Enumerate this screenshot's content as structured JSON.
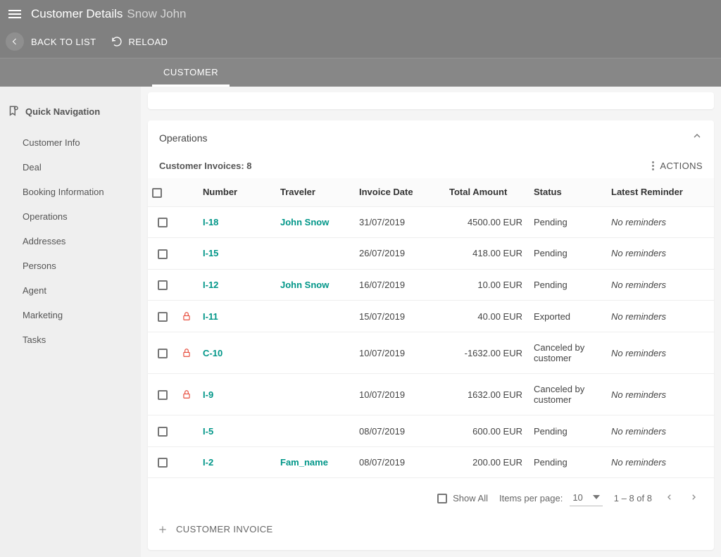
{
  "header": {
    "titlePrefix": "Customer Details",
    "titleName": "Snow John",
    "backLabel": "BACK TO LIST",
    "reloadLabel": "RELOAD",
    "activeTab": "CUSTOMER"
  },
  "sidebar": {
    "title": "Quick Navigation",
    "items": [
      "Customer Info",
      "Deal",
      "Booking Information",
      "Operations",
      "Addresses",
      "Persons",
      "Agent",
      "Marketing",
      "Tasks"
    ]
  },
  "card": {
    "title": "Operations",
    "invoicesHeader": "Customer Invoices: 8",
    "actionsLabel": "ACTIONS",
    "columns": {
      "number": "Number",
      "traveler": "Traveler",
      "invoiceDate": "Invoice Date",
      "totalAmount": "Total Amount",
      "status": "Status",
      "latestReminder": "Latest Reminder"
    },
    "rows": [
      {
        "locked": false,
        "number": "I-18",
        "traveler": "John Snow",
        "date": "31/07/2019",
        "amount": "4500.00 EUR",
        "status": "Pending",
        "reminder": "No reminders"
      },
      {
        "locked": false,
        "number": "I-15",
        "traveler": "",
        "date": "26/07/2019",
        "amount": "418.00 EUR",
        "status": "Pending",
        "reminder": "No reminders"
      },
      {
        "locked": false,
        "number": "I-12",
        "traveler": "John Snow",
        "date": "16/07/2019",
        "amount": "10.00 EUR",
        "status": "Pending",
        "reminder": "No reminders"
      },
      {
        "locked": true,
        "number": "I-11",
        "traveler": "",
        "date": "15/07/2019",
        "amount": "40.00 EUR",
        "status": "Exported",
        "reminder": "No reminders"
      },
      {
        "locked": true,
        "number": "C-10",
        "traveler": "",
        "date": "10/07/2019",
        "amount": "-1632.00 EUR",
        "status": "Canceled by customer",
        "reminder": "No reminders"
      },
      {
        "locked": true,
        "number": "I-9",
        "traveler": "",
        "date": "10/07/2019",
        "amount": "1632.00 EUR",
        "status": "Canceled by customer",
        "reminder": "No reminders"
      },
      {
        "locked": false,
        "number": "I-5",
        "traveler": "",
        "date": "08/07/2019",
        "amount": "600.00 EUR",
        "status": "Pending",
        "reminder": "No reminders"
      },
      {
        "locked": false,
        "number": "I-2",
        "traveler": "Fam_name",
        "date": "08/07/2019",
        "amount": "200.00 EUR",
        "status": "Pending",
        "reminder": "No reminders"
      }
    ],
    "footer": {
      "showAll": "Show All",
      "itemsPerPageLabel": "Items per page:",
      "itemsPerPage": "10",
      "range": "1 – 8 of 8"
    },
    "addInvoiceLabel": "CUSTOMER INVOICE"
  }
}
